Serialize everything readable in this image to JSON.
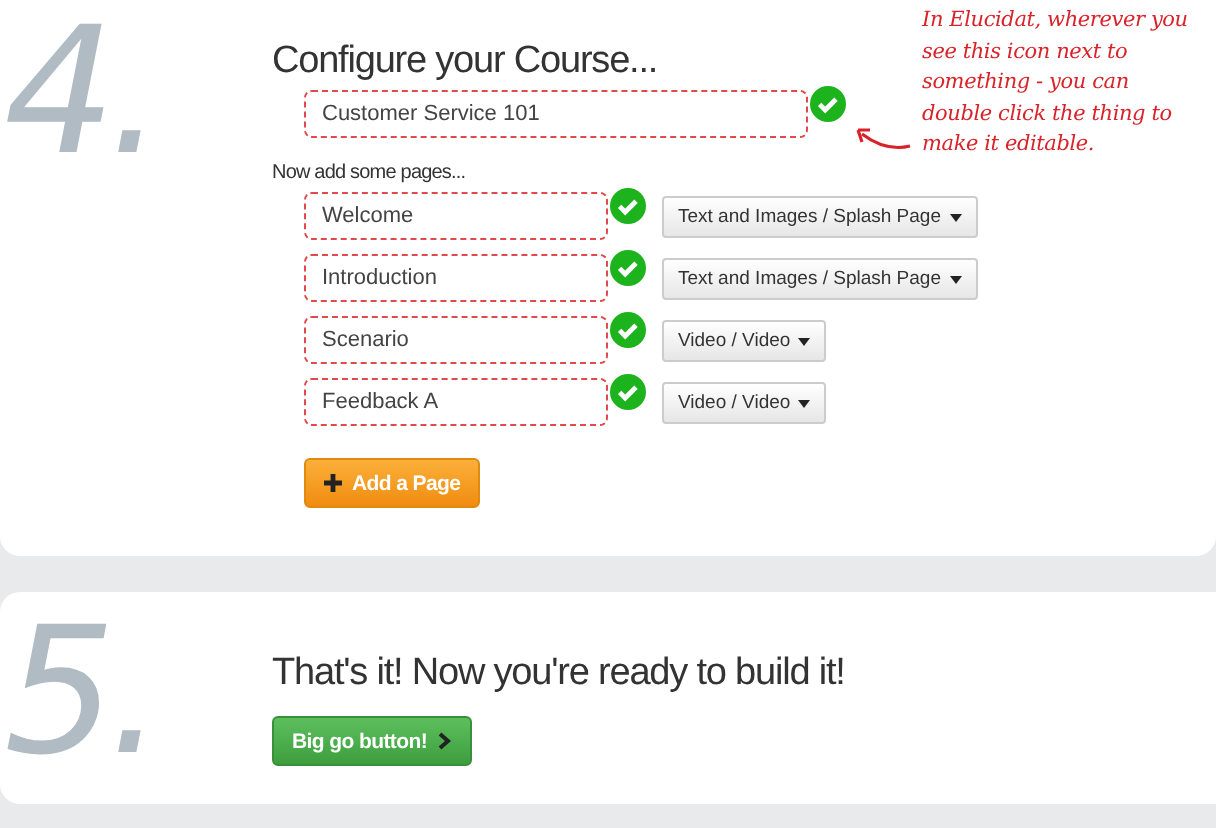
{
  "configure": {
    "number": "4.",
    "title": "Configure your Course...",
    "course_name": "Customer Service 101",
    "note_lines": [
      "In Elucidat, wherever you",
      "see this icon next to",
      "something - you can",
      "double click the thing to",
      "make it editable."
    ],
    "pages_label": "Now add some pages...",
    "pages": [
      {
        "name": "Welcome",
        "type": "Text and Images / Splash Page"
      },
      {
        "name": "Introduction",
        "type": "Text and Images / Splash Page"
      },
      {
        "name": "Scenario",
        "type": "Video / Video"
      },
      {
        "name": "Feedback A",
        "type": "Video / Video"
      }
    ],
    "add_button": "Add a Page"
  },
  "finish": {
    "number": "5.",
    "title": "That's it! Now you're ready to build it!",
    "go_button": "Big go button!"
  }
}
